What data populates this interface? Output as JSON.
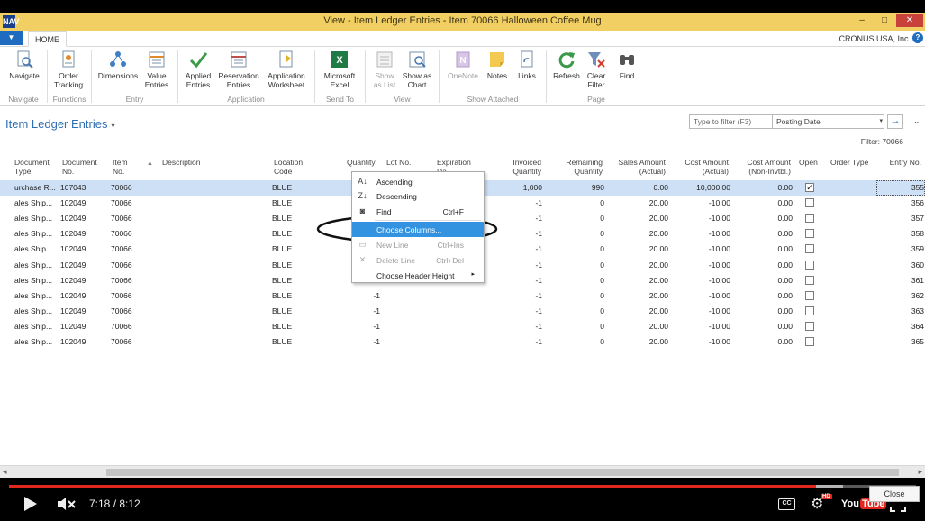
{
  "window": {
    "title": "View - Item Ledger Entries - Item 70066 Halloween Coffee Mug",
    "app_icon": "nav-logo-icon",
    "minimize": "–",
    "maximize": "□",
    "close": "✕"
  },
  "ribbon_tabs": {
    "app_menu": "▼",
    "home": "HOME",
    "company": "CRONUS USA, Inc.",
    "help": "?"
  },
  "ribbon": {
    "navigate": {
      "line1": "Navigate",
      "line2": ""
    },
    "order_tracking": {
      "line1": "Order",
      "line2": "Tracking"
    },
    "dimensions": {
      "line1": "Dimensions",
      "line2": ""
    },
    "value_entries": {
      "line1": "Value",
      "line2": "Entries"
    },
    "applied_entries": {
      "line1": "Applied",
      "line2": "Entries"
    },
    "reservation_entries": {
      "line1": "Reservation",
      "line2": "Entries"
    },
    "application_worksheet": {
      "line1": "Application",
      "line2": "Worksheet"
    },
    "microsoft_excel": {
      "line1": "Microsoft",
      "line2": "Excel"
    },
    "show_as_list": {
      "line1": "Show",
      "line2": "as List"
    },
    "show_as_chart": {
      "line1": "Show as",
      "line2": "Chart"
    },
    "onenote": {
      "line1": "OneNote",
      "line2": ""
    },
    "notes": {
      "line1": "Notes",
      "line2": ""
    },
    "links": {
      "line1": "Links",
      "line2": ""
    },
    "refresh": {
      "line1": "Refresh",
      "line2": ""
    },
    "clear_filter": {
      "line1": "Clear",
      "line2": "Filter"
    },
    "find": {
      "line1": "Find",
      "line2": ""
    },
    "groups": {
      "navigate": "Navigate",
      "functions": "Functions",
      "entry": "Entry",
      "application": "Application",
      "send_to": "Send To",
      "view": "View",
      "show_attached": "Show Attached",
      "page": "Page"
    }
  },
  "page": {
    "title": "Item Ledger Entries",
    "title_caret": "▾",
    "filter_placeholder": "Type to filter (F3)",
    "filter_field": "Posting Date",
    "filter_dropdown": "▾",
    "go_arrow": "→",
    "collapse": "⌄",
    "filter_info": "Filter: 70066"
  },
  "columns": {
    "doc_type": {
      "l1": "Document",
      "l2": "Type"
    },
    "doc_no": {
      "l1": "Document",
      "l2": "No."
    },
    "item_no": {
      "l1": "Item",
      "l2": "No."
    },
    "sort_arrow": "▲",
    "description": {
      "l1": "Description",
      "l2": ""
    },
    "location": {
      "l1": "Location",
      "l2": "Code"
    },
    "quantity": {
      "l1": "Quantity",
      "l2": ""
    },
    "lot_no": {
      "l1": "Lot No.",
      "l2": ""
    },
    "expiration": {
      "l1": "Expiration",
      "l2": "Da"
    },
    "invoiced": {
      "l1": "Invoiced",
      "l2": "Quantity"
    },
    "remaining": {
      "l1": "Remaining",
      "l2": "Quantity"
    },
    "sales_amt": {
      "l1": "Sales Amount",
      "l2": "(Actual)"
    },
    "cost_amt": {
      "l1": "Cost Amount",
      "l2": "(Actual)"
    },
    "cost_noninv": {
      "l1": "Cost Amount",
      "l2": "(Non-Invtbl.)"
    },
    "open": {
      "l1": "Open",
      "l2": ""
    },
    "order_type": {
      "l1": "Order Type",
      "l2": ""
    },
    "entry_no": {
      "l1": "Entry No.",
      "l2": ""
    }
  },
  "rows": [
    {
      "doc_type": "urchase R...",
      "doc_no": "107043",
      "item_no": "70066",
      "location": "BLUE",
      "quantity": "",
      "invoiced": "1,000",
      "remaining": "990",
      "sales": "0.00",
      "cost": "10,000.00",
      "noninv": "0.00",
      "open": true,
      "entry": "355"
    },
    {
      "doc_type": "ales Ship...",
      "doc_no": "102049",
      "item_no": "70066",
      "location": "BLUE",
      "quantity": "",
      "invoiced": "-1",
      "remaining": "0",
      "sales": "20.00",
      "cost": "-10.00",
      "noninv": "0.00",
      "open": false,
      "entry": "356"
    },
    {
      "doc_type": "ales Ship...",
      "doc_no": "102049",
      "item_no": "70066",
      "location": "BLUE",
      "quantity": "",
      "invoiced": "-1",
      "remaining": "0",
      "sales": "20.00",
      "cost": "-10.00",
      "noninv": "0.00",
      "open": false,
      "entry": "357"
    },
    {
      "doc_type": "ales Ship...",
      "doc_no": "102049",
      "item_no": "70066",
      "location": "BLUE",
      "quantity": "",
      "invoiced": "-1",
      "remaining": "0",
      "sales": "20.00",
      "cost": "-10.00",
      "noninv": "0.00",
      "open": false,
      "entry": "358"
    },
    {
      "doc_type": "ales Ship...",
      "doc_no": "102049",
      "item_no": "70066",
      "location": "BLUE",
      "quantity": "",
      "invoiced": "-1",
      "remaining": "0",
      "sales": "20.00",
      "cost": "-10.00",
      "noninv": "0.00",
      "open": false,
      "entry": "359"
    },
    {
      "doc_type": "ales Ship...",
      "doc_no": "102049",
      "item_no": "70066",
      "location": "BLUE",
      "quantity": "",
      "invoiced": "-1",
      "remaining": "0",
      "sales": "20.00",
      "cost": "-10.00",
      "noninv": "0.00",
      "open": false,
      "entry": "360"
    },
    {
      "doc_type": "ales Ship...",
      "doc_no": "102049",
      "item_no": "70066",
      "location": "BLUE",
      "quantity": "",
      "invoiced": "-1",
      "remaining": "0",
      "sales": "20.00",
      "cost": "-10.00",
      "noninv": "0.00",
      "open": false,
      "entry": "361"
    },
    {
      "doc_type": "ales Ship...",
      "doc_no": "102049",
      "item_no": "70066",
      "location": "BLUE",
      "quantity": "-1",
      "invoiced": "-1",
      "remaining": "0",
      "sales": "20.00",
      "cost": "-10.00",
      "noninv": "0.00",
      "open": false,
      "entry": "362"
    },
    {
      "doc_type": "ales Ship...",
      "doc_no": "102049",
      "item_no": "70066",
      "location": "BLUE",
      "quantity": "-1",
      "invoiced": "-1",
      "remaining": "0",
      "sales": "20.00",
      "cost": "-10.00",
      "noninv": "0.00",
      "open": false,
      "entry": "363"
    },
    {
      "doc_type": "ales Ship...",
      "doc_no": "102049",
      "item_no": "70066",
      "location": "BLUE",
      "quantity": "-1",
      "invoiced": "-1",
      "remaining": "0",
      "sales": "20.00",
      "cost": "-10.00",
      "noninv": "0.00",
      "open": false,
      "entry": "364"
    },
    {
      "doc_type": "ales Ship...",
      "doc_no": "102049",
      "item_no": "70066",
      "location": "BLUE",
      "quantity": "-1",
      "invoiced": "-1",
      "remaining": "0",
      "sales": "20.00",
      "cost": "-10.00",
      "noninv": "0.00",
      "open": false,
      "entry": "365"
    }
  ],
  "context_menu": {
    "ascending": "Ascending",
    "descending": "Descending",
    "find": "Find",
    "find_shortcut": "Ctrl+F",
    "choose_columns": "Choose Columns...",
    "new_line": "New Line",
    "new_line_shortcut": "Ctrl+Ins",
    "delete_line": "Delete Line",
    "delete_line_shortcut": "Ctrl+Del",
    "choose_header_height": "Choose Header Height",
    "submenu_arrow": "▸"
  },
  "scrollbar": {
    "left": "◂",
    "right": "▸"
  },
  "close_button": "Close",
  "player": {
    "time": "7:18 / 8:12",
    "progress": 0.89,
    "buffered": 0.92,
    "cc": "CC",
    "hd": "HD",
    "youtube_you": "You",
    "youtube_tube": "Tube",
    "settings": "⚙"
  },
  "colors": {
    "titlebar": "#f1cf63",
    "accent_blue": "#2f6eb2",
    "menu_highlight": "#3393e0",
    "annotation_ring": "#111111",
    "progress_red": "#e1281f"
  }
}
